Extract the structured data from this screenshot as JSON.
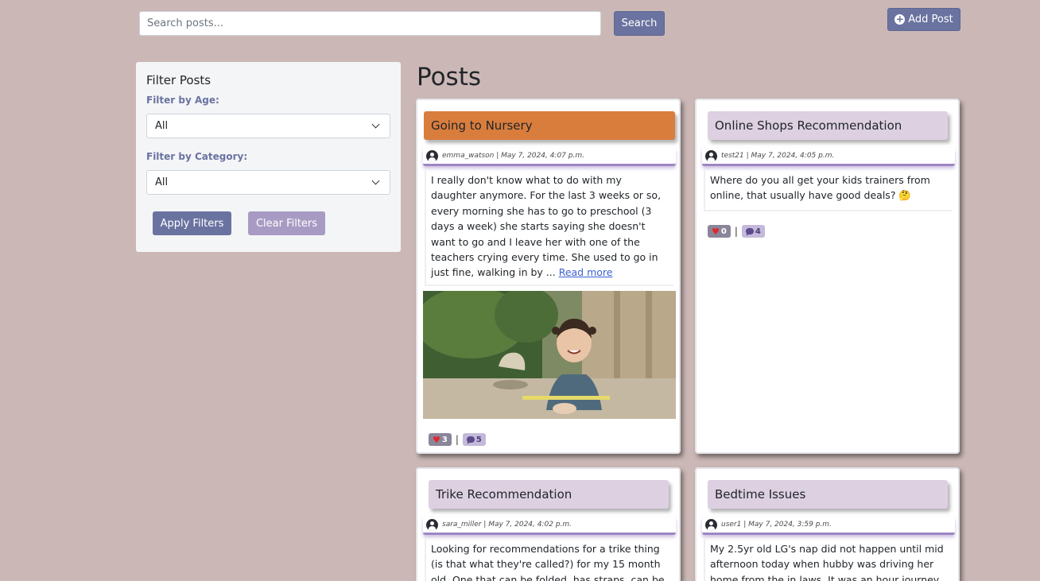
{
  "search": {
    "placeholder": "Search posts...",
    "button_label": "Search"
  },
  "add_post": {
    "label": "Add Post"
  },
  "filter": {
    "title": "Filter Posts",
    "age_label": "Filter by Age:",
    "age_value": "All",
    "category_label": "Filter by Category:",
    "category_value": "All",
    "apply_label": "Apply Filters",
    "clear_label": "Clear Filters"
  },
  "page_heading": "Posts",
  "posts": [
    {
      "title": "Going to Nursery",
      "author": "emma_watson",
      "date": "May 7, 2024, 4:07 p.m.",
      "body": "I really don't know what to do with my daughter anymore. For the last 3 weeks or so, every morning she has to go to preschool (3 days a week) she starts saying she doesn't want to go and I leave her with one of the teachers crying every time. She used to go in just fine, walking in by ...",
      "read_more": "Read more",
      "has_image": true,
      "likes": "3",
      "comments": "5"
    },
    {
      "title": "Online Shops Recommendation",
      "author": "test21",
      "date": "May 7, 2024, 4:05 p.m.",
      "body": "Where do you all get your kids trainers from online, that usually have good deals? 🤔",
      "likes": "0",
      "comments": "4"
    },
    {
      "title": "Trike Recommendation",
      "author": "sara_miller",
      "date": "May 7, 2024, 4:02 p.m.",
      "body": "Looking for recommendations for a trike thing (is that what they're called?) for my 15 month old. One that can be folded, has straps, can be"
    },
    {
      "title": "Bedtime Issues",
      "author": "user1",
      "date": "May 7, 2024, 3:59 p.m.",
      "body": "My 2.5yr old LG's nap did not happen until mid afternoon today when hubby was driving her home from the in laws. It was an hour journey"
    }
  ],
  "colors": {
    "background": "#cbb8b6",
    "primary": "#6a73a0",
    "secondary": "#a79bc3",
    "highlight_title": "#d97d3d",
    "card_title": "#ddd0e1"
  }
}
